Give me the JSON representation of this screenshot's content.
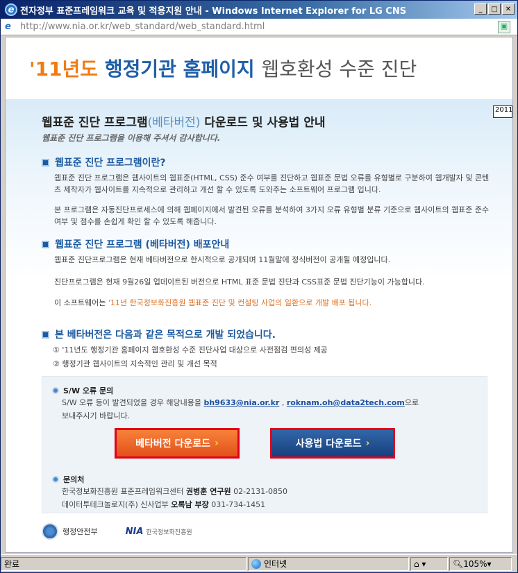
{
  "window": {
    "title": "전자정부 표준프레임워크 교육 및 적용지원 안내 - Windows Internet Explorer for LG CNS",
    "minimize": "_",
    "maximize": "□",
    "close": "✕"
  },
  "address": {
    "url": "http://www.nia.or.kr/web_standard/web_standard.html"
  },
  "header": {
    "year": "'11년도",
    "title_main": "행정기관 홈페이지",
    "title_rest": "웹호환성 수준 진단"
  },
  "tab_label": "2011",
  "page": {
    "heading_a": "웹표준 진단 프로그램",
    "heading_beta": "(베타버전)",
    "heading_b": "다운로드 및 사용법 안내",
    "subtitle": "웹표준 진단 프로그램을 이용해 주셔서 감사합니다."
  },
  "section1": {
    "title": "웹표준 진단 프로그램이란?",
    "p1": "웹표준 진단 프로그램은 웹사이트의 웹표준(HTML, CSS) 준수 여부를 진단하고 웹표준 문법 오류를 유형별로 구분하여 웹개발자 및 콘텐츠 제작자가 웹사이트를 지속적으로 관리하고 개선 할 수 있도록 도와주는 소프트웨어 프로그램 입니다.",
    "p2": "본 프로그램은 자동진단프로세스에 의해 웹페이지에서 발견된 오류를 분석하여 3가지 오류 유형별 분류 기준으로 웹사이트의 웹표준 준수 여부 및 점수를 손쉽게 확인 할 수 있도록 해줍니다."
  },
  "section2": {
    "title": "웹표준 진단 프로그램 (베타버전) 배포안내",
    "p1": "웹표준 진단프로그램은 현재 베타버전으로 한시적으로 공개되며 11월말에 정식버전이 공개될 예정입니다.",
    "p2": "진단프로그램은 현재 9월26일 업데이트된 버전으로  HTML 표준 문법 진단과 CSS표준 문법 진단기능이 가능합니다.",
    "p3_a": "이 소프트웨어는",
    "p3_b": "'11년 한국정보화진흥원 웹표준 진단 및 컨설팅 사업의 일환으로 개발 배포 됩니다."
  },
  "section3": {
    "title": "본 베타버전은 다음과 같은 목적으로 개발 되었습니다.",
    "item1": "① '11년도 행정기관 홈페이지 웹호환성 수준 진단사업 대상으로 사전점검 편의성 제공",
    "item2": "② 행정기관 웹사이트의 지속적인 관리 및 개선 목적"
  },
  "box": {
    "sw_title": "S/W 오류 문의",
    "sw_text_a": "S/W 오류 등이 발견되었을 경우 해당내용을",
    "email1": "bh9633@nia.or.kr",
    "sep": ",",
    "email2": "roknam.oh@data2tech.com",
    "sw_text_b": "으로",
    "sw_text_c": "보내주시기 바랍니다.",
    "beta_btn": "베타버전 다운로드",
    "guide_btn": "사용법 다운로드",
    "contact_title": "문의처",
    "contact1_a": "한국정보화진흥원 표준프레임워크센터",
    "contact1_b": "권병훈 연구원",
    "contact1_c": "02-2131-0850",
    "contact2_a": "데이터투테크놀로지(주) 신사업부",
    "contact2_b": "오록남 부장",
    "contact2_c": "031-734-1451"
  },
  "footer": {
    "logo1": "행정안전부",
    "logo2": "NIA",
    "logo2_sub": "한국정보화진흥원"
  },
  "status": {
    "text": "완료",
    "zone": "인터넷",
    "zoom": "105%"
  }
}
